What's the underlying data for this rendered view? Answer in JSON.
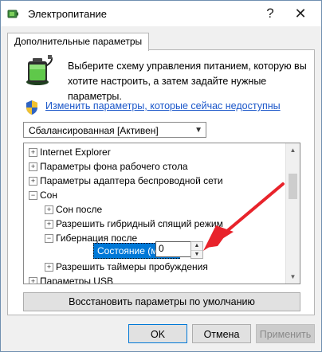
{
  "window": {
    "title": "Электропитание",
    "help_glyph": "?",
    "close_glyph": "✕"
  },
  "tab": {
    "label": "Дополнительные параметры"
  },
  "header": {
    "description": "Выберите схему управления питанием, которую вы хотите настроить, а затем задайте нужные параметры.",
    "change_link": "Изменить параметры, которые сейчас недоступны"
  },
  "plan_select": {
    "value": "Сбалансированная [Активен]"
  },
  "tree": {
    "items": [
      {
        "label": "Internet Explorer",
        "expander": "+"
      },
      {
        "label": "Параметры фона рабочего стола",
        "expander": "+"
      },
      {
        "label": "Параметры адаптера беспроводной сети",
        "expander": "+"
      },
      {
        "label": "Сон",
        "expander": "−"
      },
      {
        "label": "Сон после",
        "expander": "+"
      },
      {
        "label": "Разрешить гибридный спящий режим",
        "expander": "+"
      },
      {
        "label": "Гибернация после",
        "expander": "−"
      },
      {
        "label": "Разрешить таймеры пробуждения",
        "expander": "+"
      },
      {
        "label": "Параметры USB",
        "expander": "+"
      }
    ],
    "state_label": "Состояние (мин.):",
    "state_value": "0"
  },
  "buttons": {
    "restore": "Восстановить параметры по умолчанию",
    "ok": "OK",
    "cancel": "Отмена",
    "apply": "Применить"
  },
  "icons": {
    "app": "power-options-icon",
    "battery": "battery-plug-icon",
    "shield": "uac-shield-icon"
  },
  "colors": {
    "accent": "#0078d7",
    "link": "#1a56c9",
    "arrow": "#e8232b"
  }
}
